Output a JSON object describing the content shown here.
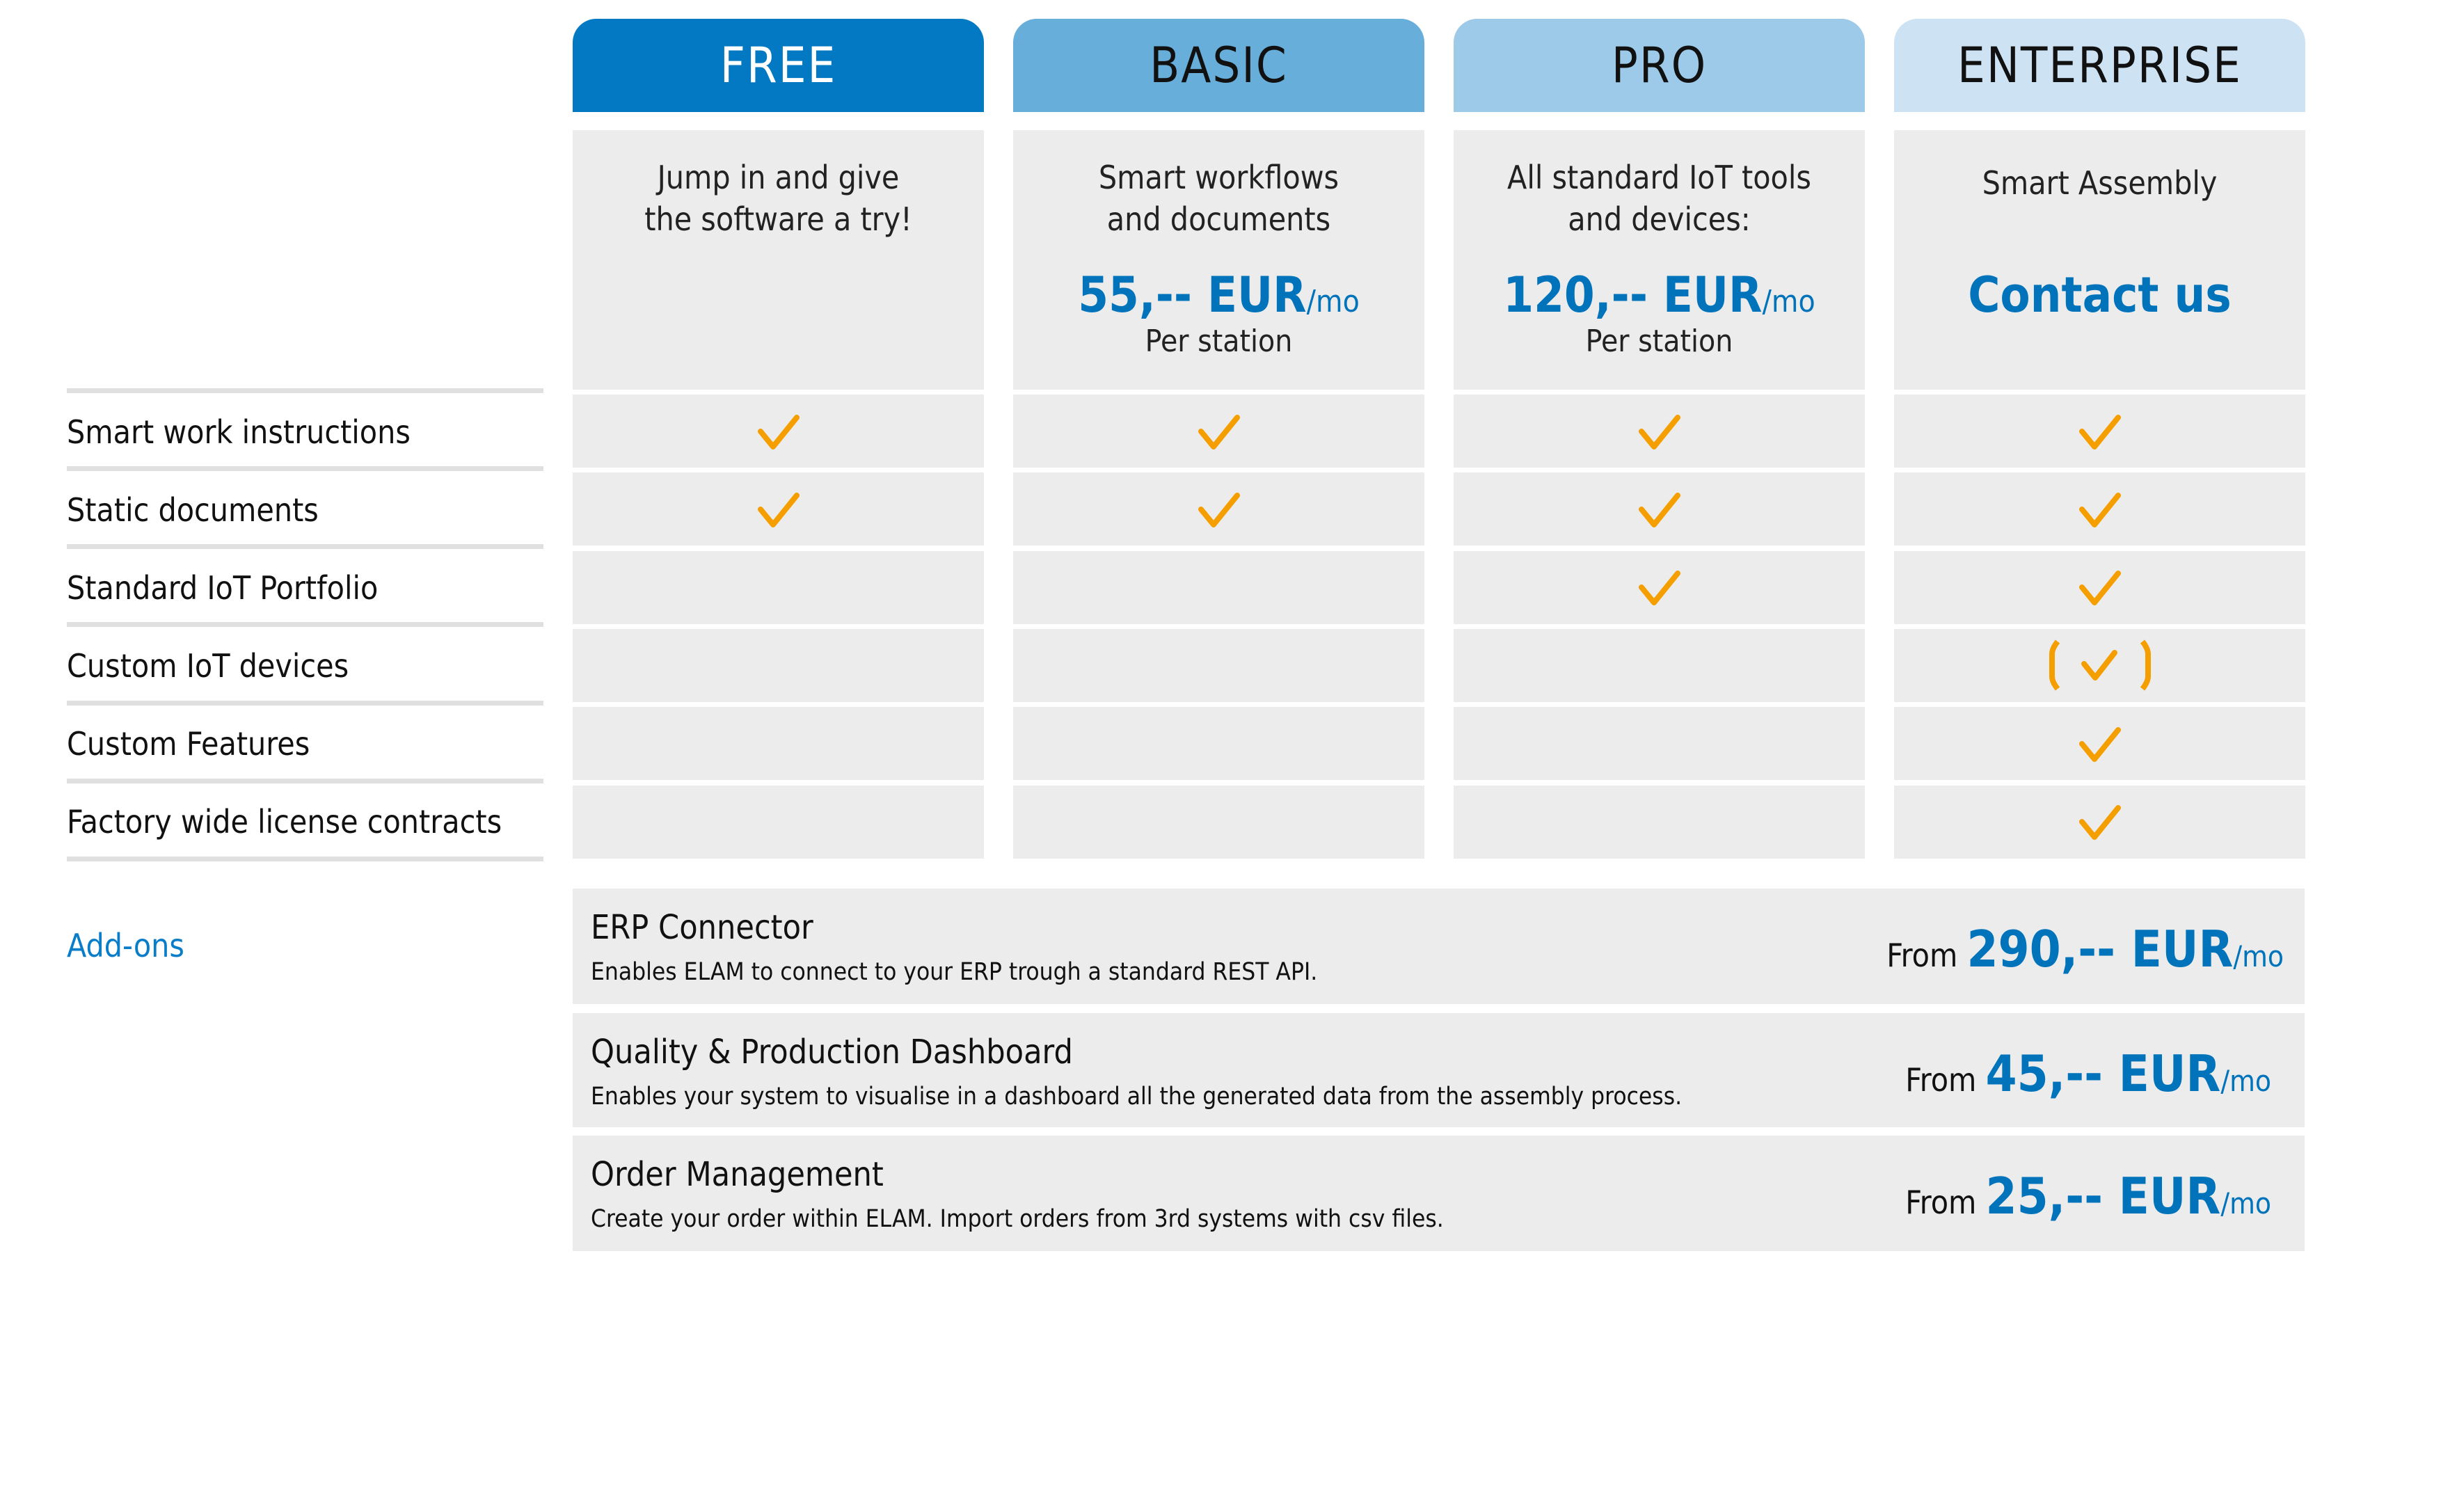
{
  "colors": {
    "accent": "#0073bb",
    "check": "#f59e00",
    "free_header": "#0279c2",
    "basic_header": "#67aeda",
    "pro_header": "#9ccae8",
    "enterprise_header": "#cde3f3",
    "cell_bg": "#ececec"
  },
  "plans": [
    {
      "name": "FREE",
      "description": "Jump in and give\nthe software a try!",
      "price": "",
      "per": "",
      "station": "",
      "contact": ""
    },
    {
      "name": "BASIC",
      "description": "Smart workflows\nand documents",
      "price": "55,-- EUR",
      "per": "/mo",
      "station": "Per station",
      "contact": ""
    },
    {
      "name": "PRO",
      "description": "All standard IoT tools\nand devices:",
      "price": "120,-- EUR",
      "per": "/mo",
      "station": "Per station",
      "contact": ""
    },
    {
      "name": "ENTERPRISE",
      "description": "Smart Assembly",
      "price": "",
      "per": "",
      "station": "",
      "contact": "Contact us"
    }
  ],
  "features": [
    {
      "label": "Smart work instructions",
      "availability": [
        "yes",
        "yes",
        "yes",
        "yes"
      ]
    },
    {
      "label": "Static documents",
      "availability": [
        "yes",
        "yes",
        "yes",
        "yes"
      ]
    },
    {
      "label": "Standard IoT Portfolio",
      "availability": [
        "no",
        "no",
        "yes",
        "yes"
      ]
    },
    {
      "label": "Custom IoT devices",
      "availability": [
        "no",
        "no",
        "no",
        "partial"
      ]
    },
    {
      "label": "Custom Features",
      "availability": [
        "no",
        "no",
        "no",
        "yes"
      ]
    },
    {
      "label": "Factory wide license contracts",
      "availability": [
        "no",
        "no",
        "no",
        "yes"
      ]
    }
  ],
  "addons": {
    "label": "Add-ons",
    "items": [
      {
        "name": "ERP Connector",
        "description": "Enables ELAM to connect to your ERP trough a standard REST API.",
        "from": "From",
        "price": "290,-- EUR",
        "per": "/mo"
      },
      {
        "name": "Quality & Production Dashboard",
        "description": "Enables your system to visualise in a dashboard all the generated data from the assembly process.",
        "from": "From",
        "price": "45,-- EUR",
        "per": "/mo"
      },
      {
        "name": "Order Management",
        "description": "Create your order within ELAM. Import orders from 3rd systems with csv files.",
        "from": "From",
        "price": "25,-- EUR",
        "per": "/mo"
      }
    ]
  }
}
